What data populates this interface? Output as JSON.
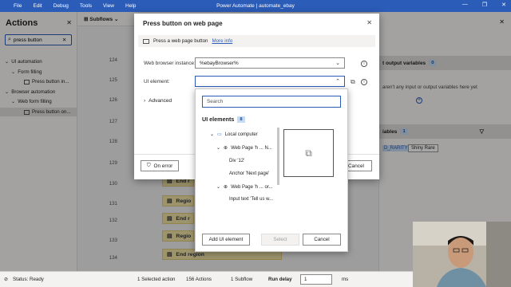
{
  "app": {
    "title": "Power Automate | automate_ebay",
    "menu": [
      "File",
      "Edit",
      "Debug",
      "Tools",
      "View",
      "Help"
    ],
    "window_buttons": [
      "—",
      "❐",
      "✕"
    ]
  },
  "actions_pane": {
    "title": "Actions",
    "search_value": "press button",
    "tree": [
      {
        "label": "UI automation",
        "level": 0
      },
      {
        "label": "Form filling",
        "level": 1
      },
      {
        "label": "Press button in...",
        "level": 2
      },
      {
        "label": "Browser automation",
        "level": 0
      },
      {
        "label": "Web form filling",
        "level": 1
      },
      {
        "label": "Press button on...",
        "level": 2
      }
    ]
  },
  "designer": {
    "subflows_label": "Subflows",
    "line_numbers": [
      "124",
      "125",
      "126",
      "127",
      "128",
      "129",
      "130",
      "131",
      "132",
      "133",
      "134"
    ],
    "blocks": [
      "End r",
      "Regio",
      "End r",
      "Regio",
      "End region"
    ]
  },
  "vars_pane": {
    "io_header": "t output variables",
    "io_count": "0",
    "io_empty": "aren't any input or output variables here yet",
    "flow_header": "iables",
    "flow_count": "1",
    "var_name": "D_RARITY",
    "var_value": "Shiny Rare"
  },
  "dialog": {
    "title": "Press button on web page",
    "info_text": "Press a web page button",
    "info_link": "More info",
    "browser_label": "Web browser instance:",
    "browser_value": "%ebayBrowser%",
    "ui_element_label": "UI element:",
    "ui_element_value": "",
    "advanced_label": "Advanced",
    "on_error_label": "On error",
    "cancel_label": "Cancel"
  },
  "dropdown": {
    "search_placeholder": "Search",
    "heading": "UI elements",
    "count": "8",
    "items": [
      {
        "label": "Local computer",
        "level": 0,
        "icon": "computer-icon"
      },
      {
        "label": "Web Page 'h ... N...",
        "level": 1,
        "icon": "globe-icon"
      },
      {
        "label": "Div '12'",
        "level": 2,
        "icon": ""
      },
      {
        "label": "Anchor 'Next page'",
        "level": 2,
        "icon": ""
      },
      {
        "label": "Web Page 'h ... or...",
        "level": 1,
        "icon": "globe-icon"
      },
      {
        "label": "Input text 'Tell us w...",
        "level": 2,
        "icon": ""
      }
    ],
    "add_label": "Add UI element",
    "select_label": "Select",
    "cancel_label": "Cancel"
  },
  "statusbar": {
    "status": "Status: Ready",
    "selected": "1 Selected action",
    "actions": "156 Actions",
    "subflow": "1 Subflow",
    "run_delay_label": "Run delay",
    "run_delay_value": "1",
    "unit": "ms"
  },
  "colors": {
    "accent": "#2b5cb8",
    "region": "#f2e3a6",
    "badge": "#c7dcf4"
  }
}
